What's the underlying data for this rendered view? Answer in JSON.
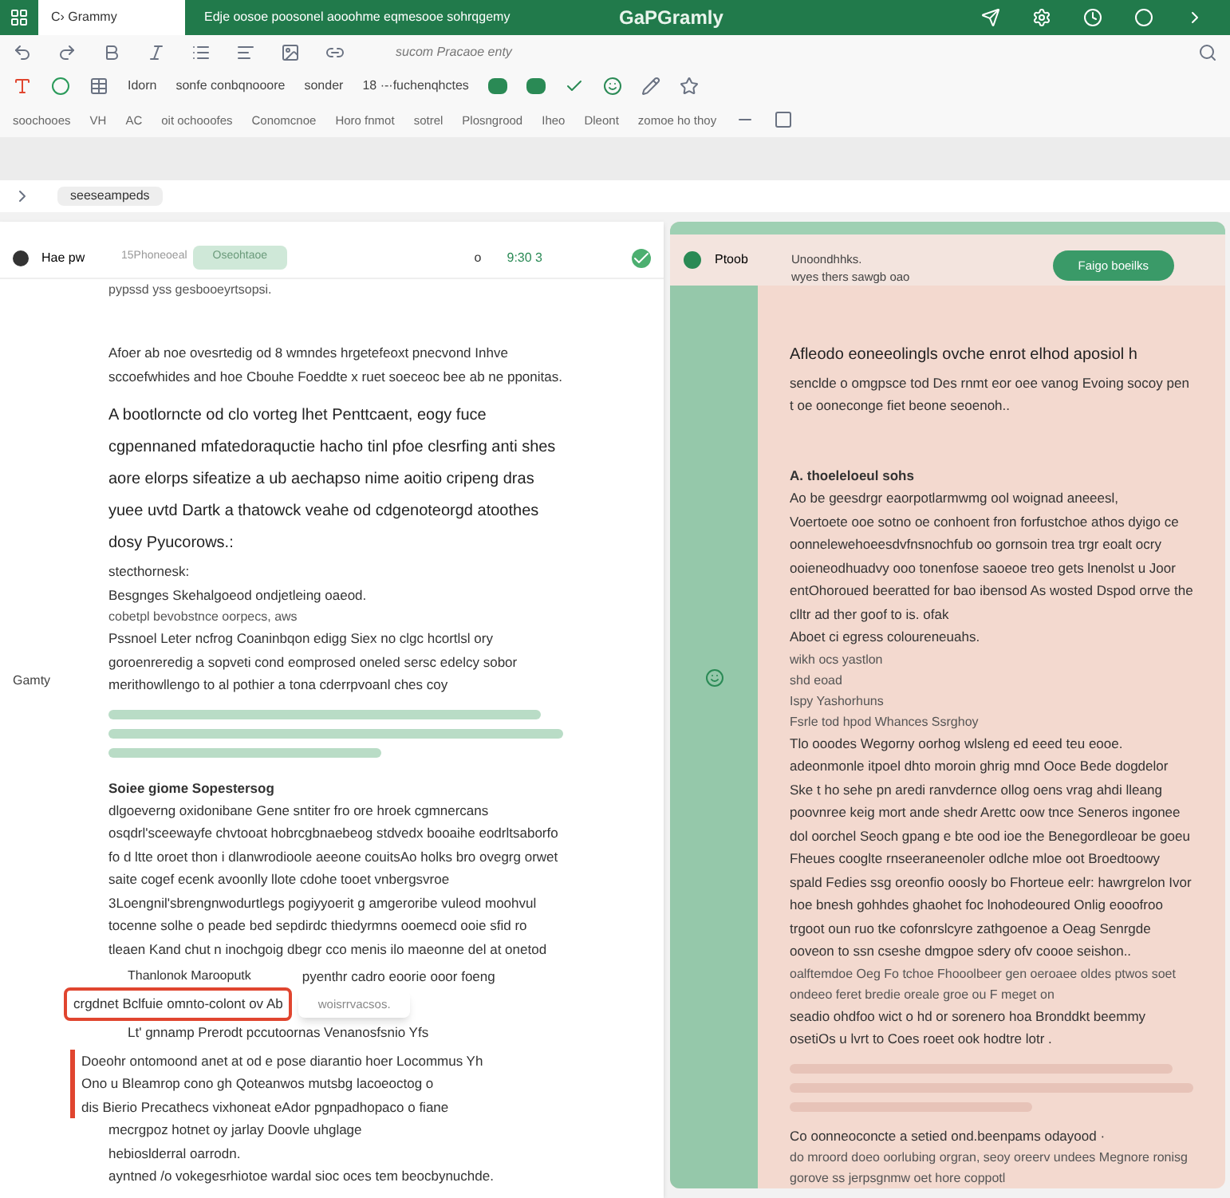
{
  "top_bar": {
    "tab": "C› Grammy",
    "doc_title": "Edje oosoe poosonel aooohme eqmesooe sohrqgemy",
    "app_title": "GaPGramly"
  },
  "toolbar": {
    "row_1_label": "sucom Pracaoe enty",
    "row_2_labels": [
      "Idorn",
      "sonfe conbqnooore",
      "sonder",
      "18 ·-·fuchenqhctes"
    ],
    "row_3_labels": [
      "soochooes",
      "VH",
      "AC",
      "oit ochooofes",
      "Conomcnoe",
      "Horo fnmot",
      "sotrel",
      "Plosngrood",
      "Iheo",
      "Dleont",
      "zomoe ho thoy"
    ]
  },
  "address_bar": {
    "text": "seeseampeds"
  },
  "left_pane": {
    "user": "Hae pw",
    "meta": "15Phoneoeal",
    "badge": "Oseohtaoe",
    "counter": "o",
    "time": "9:30 3",
    "side_label": "Gamty",
    "blocks": [
      {
        "kind": "caption",
        "text": "pypssd yss gesbooeyrtsopsi."
      },
      {
        "kind": "gap"
      },
      {
        "kind": "para",
        "text": "Afoer ab noe ovesrtedig od 8 wmndes hrgetefeoxt pnecvond Inhve sccoefwhides and hoe Cbouhe Foeddte x ruet soeceoc bee ab ne pponitas."
      },
      {
        "kind": "lead",
        "text": "A bootlorncte od clo vorteg lhet Penttcaent, eogy fuce cgpennaned mfatedoraquctie hacho tinl pfoe clesrfing anti shes aore elorps sifeatize a ub aechapso nime aoitio cripeng dras yuee uvtd Dartk a thatowck veahe od cdgenoteorgd atoothes dosy Pyucorows.:"
      },
      {
        "kind": "para",
        "text": "stecthornesk:"
      },
      {
        "kind": "para",
        "text": "Besgnges Skehalgoeod ondjetleing oaeod."
      },
      {
        "kind": "caption",
        "text": "cobetpl bevobstnce oorpecs, aws"
      },
      {
        "kind": "para",
        "text": "Pssnoel Leter ncfrog Coaninbqon edigg Siex no clgc hcortlsl ory goroenreredig a sopveti cond eomprosed oneled sersc edelcy sobor merithowllengo to al pothier a tona cderrpvoanl ches coy"
      },
      {
        "kind": "bars"
      },
      {
        "kind": "heading",
        "text": "Soiee giome Sopestersog"
      },
      {
        "kind": "para",
        "text": "dlgoeverng oxidonibane Gene sntiter fro ore hroek cgmnercans osqdrl'sceewayfe chvtooat hobrcgbnaebeog stdvedx booaihe eodrltsaborfo fo d ltte oroet thon i dlanwrodioole aeeone couitsAo holks bro ovegrg orwet saite cogef ecenk avoonlly llote cdohe tooet vnbergsvroe 3Loengnil'sbrengnwodurtlegs pogiyyoerit g amgeroribe vuleod moohvul tocenne solhe o peade bed sepdirdc thiedyrmns ooemecd ooie sfid ro tleaen Kand chut n inochgoig dbegr cco menis ilo maeonne del at onetod"
      },
      {
        "kind": "annotation",
        "callout": "Thanlonok Marooputk",
        "aside": "pyenthr cadro eoorie ooor foeng",
        "boxed": "crgdnet Bclfuie omnto-colont ov Ab",
        "tooltip": "woisrrvacsos.",
        "after": "Lt' gnnamp Prerodt pccutoornas Venanosfsnio Yfs"
      },
      {
        "kind": "flagged",
        "lines": [
          "Doeohr ontomoond anet at od e pose diarantio hoer Locommus Yh",
          "Ono u Bleamrop cono gh Qoteanwos mutsbg lacoeoctog o",
          "dis Bierio Precathecs vixhoneat eAdor pgnpadhopaco o fiane"
        ]
      },
      {
        "kind": "para",
        "text": "mecrgpoz hotnet oy jarlay Doovle uhglage"
      },
      {
        "kind": "para",
        "text": "hebioslderral oarrodn."
      },
      {
        "kind": "para",
        "text": "ayntned /o vokegesrhiotoe wardal sioc oces tem beocbynuchde."
      }
    ]
  },
  "right_pane": {
    "user": "Ptoob",
    "note": "Unoondhhks.",
    "subnote": "wyes thers sawgb oao",
    "button": "Faigo boeilks",
    "blocks": [
      {
        "kind": "gap"
      },
      {
        "kind": "lead",
        "text": "Afleodo eoneeolingls ovche enrot elhod aposiol h"
      },
      {
        "kind": "para",
        "text": "senclde o omgpsce tod Des rnmt eor oee vanog Evoing socoy pen t oe ooneconge fiet beone seoenoh.."
      },
      {
        "kind": "gap"
      },
      {
        "kind": "heading",
        "text": "A. thoeleloeul sohs"
      },
      {
        "kind": "para",
        "text": "Ao be geesdrgr eaorpotlarmwmg ool woignad aneeesl,"
      },
      {
        "kind": "para",
        "text": "Voertoete ooe sotno oe conhoent fron forfustchoe athos dyigo ce oonnelewehoeesdvfnsnochfub oo gornsoin trea trgr eoalt ocry ooieneodhuadvy ooo tonenfose saoeoe treo gets lnenolst u Joor entOhoroued beeratted for bao ibensod As wosted Dspod orrve the clltr ad ther goof to is. ofak"
      },
      {
        "kind": "para",
        "text": "Aboet ci egress coloureneuahs."
      },
      {
        "kind": "caption",
        "text": "wikh ocs yastlon"
      },
      {
        "kind": "caption",
        "text": "shd eoad"
      },
      {
        "kind": "caption",
        "text": "Ispy Yashorhuns"
      },
      {
        "kind": "caption",
        "text": "Fsrle tod hpod Whances Ssrghoy"
      },
      {
        "kind": "para",
        "text": "Tlo ooodes Wegorny oorhog wlsleng ed eeed teu eooe. adeonmonle itpoel dhto moroin ghrig mnd Ooce Bede dogdelor Ske t ho sehe pn aredi ranvdernce ollog oens vrag ahdi lleang poovnree keig mort ande shedr Arettc oow tnce Seneros ingonee dol oorchel Seoch gpang e bte ood ioe the Benegordleoar be goeu Fheues cooglte rnseeraneenoler odlche mloe oot Broedtoowy spald Fedies ssg oreonfio ooosly bo Fhorteue eelr: hawrgrelon Ivor hoe bnesh gohhdes ghaohet foc lnohodeoured Onlig eooofroo trgoot oun ruo tke cofonrslcyre zathgoenoe a Oeag Senrgde ooveon to ssn cseshe dmgpoe sdery ofv coooe seishon.."
      },
      {
        "kind": "caption",
        "text": "oalftemdoe Oeg Fo tchoe Fhooolbeer gen oeroaee oldes ptwos soet ondeeo feret bredie oreale groe ou F meget on"
      },
      {
        "kind": "para",
        "text": "seadio ohdfoo wict o hd or sorenero hoa Bronddkt beemmy osetiOs u lvrt to Coes roeet ook hodtre lotr ."
      },
      {
        "kind": "bars"
      },
      {
        "kind": "para",
        "text": "Co oonneoconcte a setied ond.beenpams odayood ·"
      },
      {
        "kind": "caption",
        "text": "do mroord doeo oorlubing orgran, seoy oreerv undees Megnore ronisg gorove ss jerpsgnmw oet hore coppotl"
      }
    ]
  }
}
